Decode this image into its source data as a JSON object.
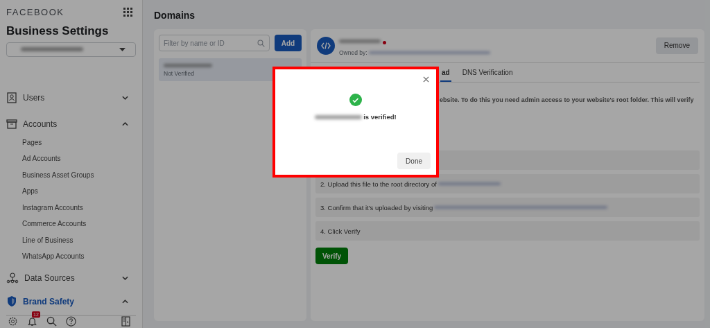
{
  "sidebar": {
    "brand": "FACEBOOK",
    "title": "Business Settings",
    "sections": [
      {
        "label": "Users",
        "expanded": false,
        "active": false
      },
      {
        "label": "Accounts",
        "expanded": true,
        "active": false,
        "children": [
          {
            "label": "Pages"
          },
          {
            "label": "Ad Accounts"
          },
          {
            "label": "Business Asset Groups"
          },
          {
            "label": "Apps"
          },
          {
            "label": "Instagram Accounts"
          },
          {
            "label": "Commerce Accounts"
          },
          {
            "label": "Line of Business"
          },
          {
            "label": "WhatsApp Accounts"
          }
        ]
      },
      {
        "label": "Data Sources",
        "expanded": false,
        "active": false
      },
      {
        "label": "Brand Safety",
        "expanded": true,
        "active": true
      }
    ],
    "notification_badge": "12"
  },
  "page_title": "Domains",
  "domain_list": {
    "filter_placeholder": "Filter by name or ID",
    "add_button": "Add",
    "items": [
      {
        "status": "Not Verified",
        "selected": true
      }
    ]
  },
  "domain_detail": {
    "owned_by_label": "Owned by:",
    "remove_button": "Remove",
    "tabs": [
      {
        "label": "ad",
        "selected": true
      },
      {
        "label": "DNS Verification",
        "selected": false
      }
    ],
    "description": "ebsite. To do this you need admin access to your website's root folder. This will verify",
    "steps": [
      {
        "kind": "hidden"
      },
      {
        "kind": "link",
        "text": "2. Upload this file to the root directory of"
      },
      {
        "kind": "link",
        "text": "3. Confirm that it's uploaded by visiting"
      },
      {
        "kind": "plain",
        "text": "4. Click Verify"
      }
    ],
    "verify_button": "Verify"
  },
  "modal": {
    "message": "is verified!",
    "done_button": "Done"
  }
}
